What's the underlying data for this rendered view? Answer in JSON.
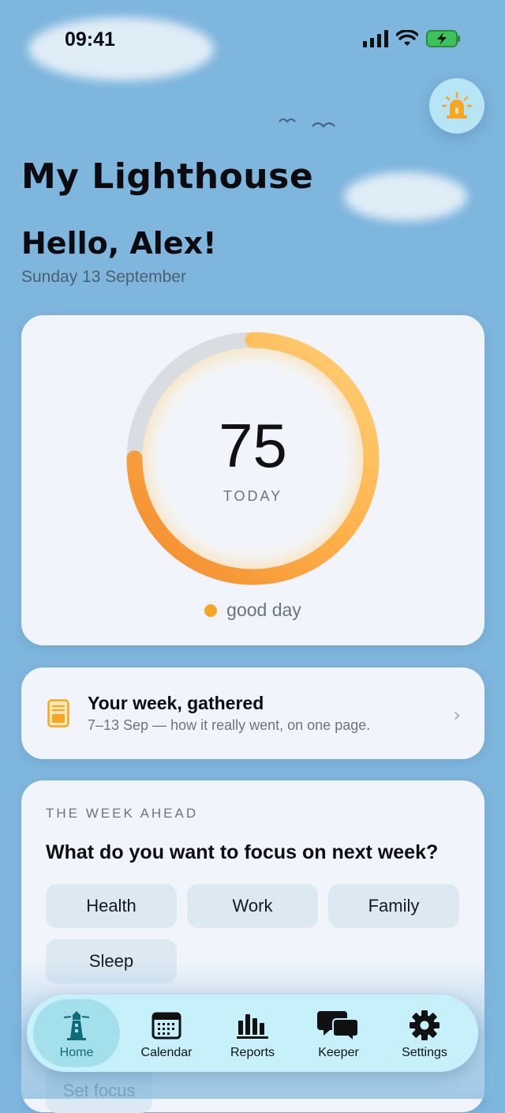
{
  "status_bar": {
    "time": "09:41"
  },
  "header": {
    "app_title": "My Lighthouse",
    "greeting": "Hello, Alex!",
    "date": "Sunday 13 September"
  },
  "score": {
    "value": "75",
    "label": "TODAY",
    "mood": "good day",
    "progress_fraction": 0.75
  },
  "week_summary": {
    "title": "Your week, gathered",
    "subtitle": "7–13 Sep — how it really went, on one page."
  },
  "week_ahead": {
    "label": "THE WEEK AHEAD",
    "question": "What do you want to focus on next week?",
    "chips": [
      "Health",
      "Work",
      "Family",
      "Sleep"
    ],
    "button_label": "Set focus"
  },
  "tabbar": {
    "items": [
      {
        "label": "Home",
        "icon": "lighthouse-icon"
      },
      {
        "label": "Calendar",
        "icon": "calendar-icon"
      },
      {
        "label": "Reports",
        "icon": "bar-chart-icon"
      },
      {
        "label": "Keeper",
        "icon": "chat-bubbles-icon"
      },
      {
        "label": "Settings",
        "icon": "gear-icon"
      }
    ]
  },
  "colors": {
    "background": "#7fb6dd",
    "accent_orange": "#f5a623",
    "tab_active": "#0f6b7a"
  }
}
